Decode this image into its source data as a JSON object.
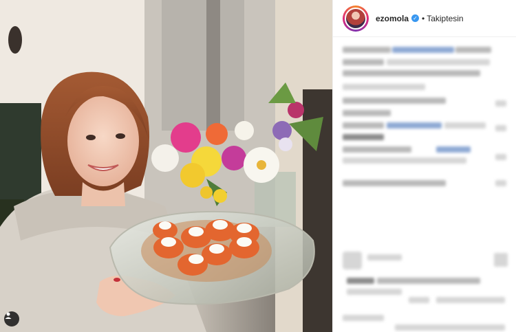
{
  "post": {
    "author": {
      "username": "ezomola",
      "verified_icon": "verified-badge-icon",
      "separator": "•",
      "follow_status": "Takiptesin"
    },
    "media": {
      "tag_icon": "user-tag-icon"
    }
  },
  "colors": {
    "verified": "#3897f0",
    "divider": "#efefef",
    "text": "#262626"
  }
}
